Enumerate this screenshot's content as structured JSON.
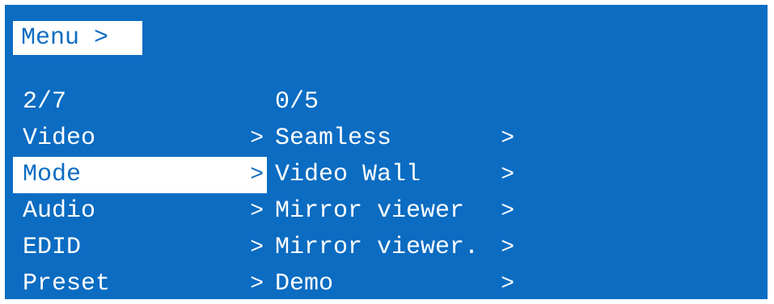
{
  "colors": {
    "background": "#0b6cc2",
    "foreground": "#ffffff"
  },
  "header": {
    "title": "Menu >"
  },
  "main_menu": {
    "counter": "2/7",
    "items": [
      {
        "label": "Video",
        "arrow": ">"
      },
      {
        "label": "Mode",
        "arrow": ">",
        "selected": true
      },
      {
        "label": "Audio",
        "arrow": ">"
      },
      {
        "label": "EDID",
        "arrow": ">"
      },
      {
        "label": "Preset",
        "arrow": ">"
      }
    ]
  },
  "sub_menu": {
    "counter": "0/5",
    "items": [
      {
        "label": "Seamless",
        "arrow": ">"
      },
      {
        "label": "Video Wall",
        "arrow": ">"
      },
      {
        "label": "Mirror viewer",
        "arrow": ">"
      },
      {
        "label": "Mirror viewer.",
        "arrow": ">"
      },
      {
        "label": "Demo",
        "arrow": ">"
      }
    ]
  }
}
